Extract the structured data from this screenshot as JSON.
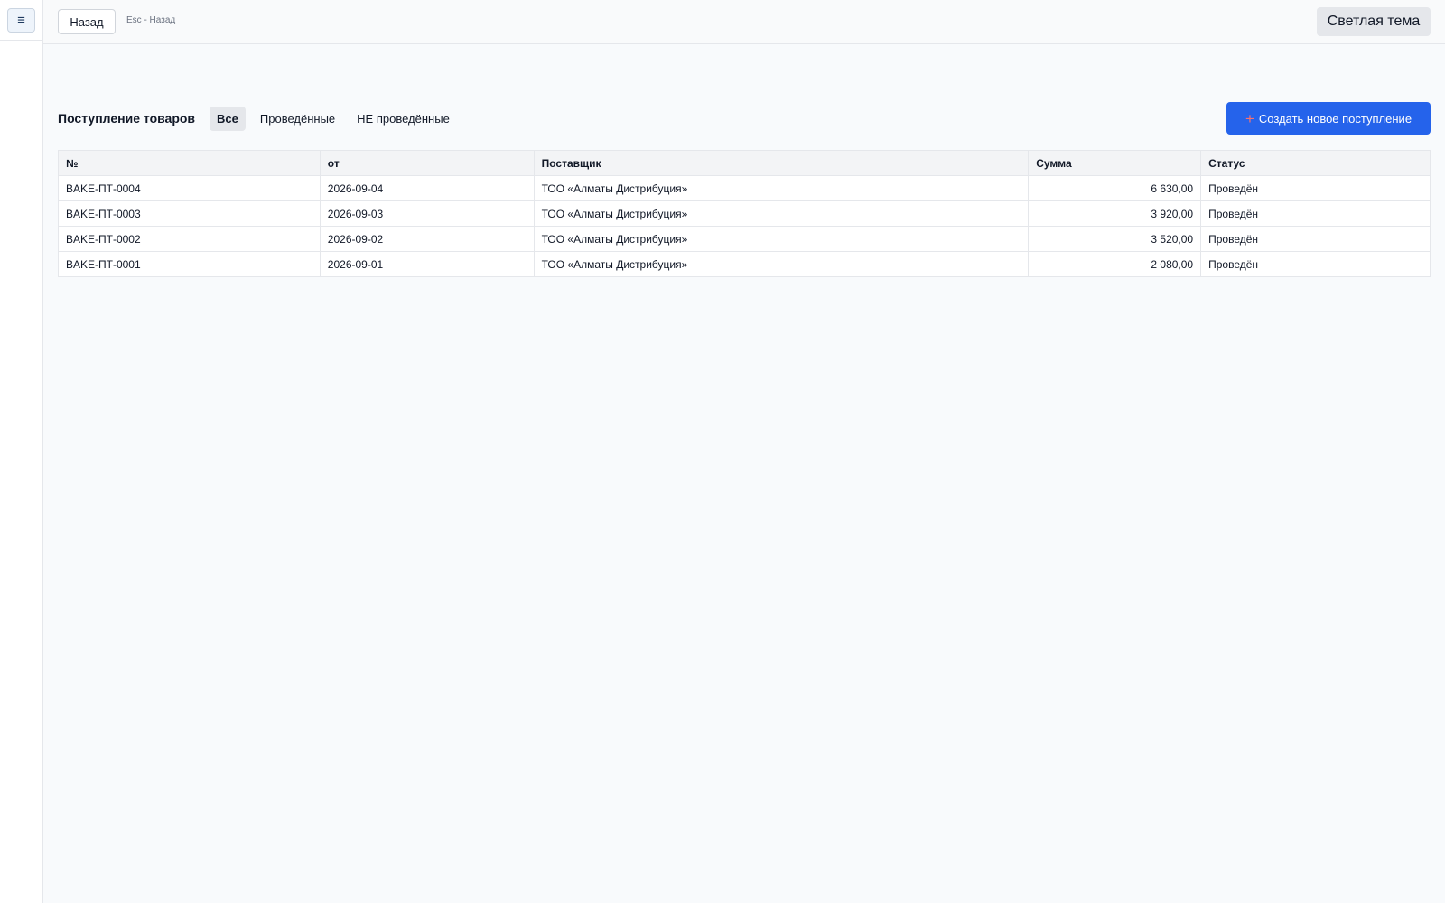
{
  "sidebar": {
    "menu_icon": "≡"
  },
  "topbar": {
    "back_label": "Назад",
    "esc_hint": "Esc - Назад",
    "theme_label": "Светлая тема"
  },
  "page": {
    "title": "Поступление товаров",
    "filters": [
      "Все",
      "Проведённые",
      "НЕ проведённые"
    ],
    "active_filter": "Все",
    "create_label": "Создать новое поступление",
    "create_icon": "+"
  },
  "table": {
    "columns": [
      "№",
      "от",
      "Поставщик",
      "Сумма",
      "Статус"
    ],
    "rows": [
      [
        "BAKE-ПТ-0004",
        "2026-09-04",
        "ТОО «Алматы Дистрибуция»",
        "6 630,00",
        "Проведён"
      ],
      [
        "BAKE-ПТ-0003",
        "2026-09-03",
        "ТОО «Алматы Дистрибуция»",
        "3 920,00",
        "Проведён"
      ],
      [
        "BAKE-ПТ-0002",
        "2026-09-02",
        "ТОО «Алматы Дистрибуция»",
        "3 520,00",
        "Проведён"
      ],
      [
        "BAKE-ПТ-0001",
        "2026-09-01",
        "ТОО «Алматы Дистрибуция»",
        "2 080,00",
        "Проведён"
      ]
    ]
  },
  "colors": {
    "primary": "#2563eb",
    "plus_icon": "#f87171",
    "border": "#e5e7eb",
    "background": "#f8fafc"
  }
}
